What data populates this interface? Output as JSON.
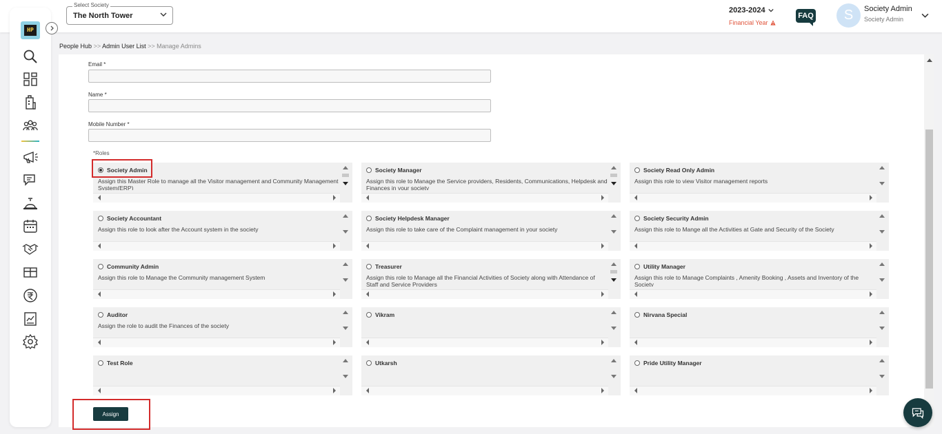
{
  "header": {
    "society_select_label": "Select Society",
    "society_select_value": "The North Tower",
    "financial_year": "2023-2024",
    "financial_year_label": "Financial Year",
    "faq": "FAQ",
    "user_initial": "S",
    "user_name": "Society Admin",
    "user_role": "Society Admin"
  },
  "sidebar": {
    "logo_text": "HP",
    "icons": [
      "search-icon",
      "dashboard-icon",
      "building-icon",
      "people-hub-icon",
      "announcement-icon",
      "chat-icon",
      "service-bell-icon",
      "calendar-icon",
      "handshake-icon",
      "amenity-icon",
      "rupee-icon",
      "report-icon",
      "settings-icon"
    ],
    "active": "people-hub-icon",
    "accent_colors": [
      "#f3c43f",
      "#2bb3c6"
    ]
  },
  "breadcrumb": {
    "items": [
      "People Hub",
      "Admin User List",
      "Manage Admins"
    ],
    "separator": ">>"
  },
  "form": {
    "email_label": "Email *",
    "email_value": "",
    "name_label": "Name *",
    "name_value": "",
    "mobile_label": "Mobile Number *",
    "mobile_value": "",
    "roles_label": "*Roles"
  },
  "roles": [
    {
      "name": "Society Admin",
      "desc": "Assign this Master Role to manage all the Visitor management and Community Management System(ERP)",
      "checked": true
    },
    {
      "name": "Society Manager",
      "desc": "Assign this role to Manage the Service providers, Residents, Communications, Helpdesk and Finances in your society",
      "checked": false
    },
    {
      "name": "Society Read Only Admin",
      "desc": "Assign this role to view Visitor management reports",
      "checked": false
    },
    {
      "name": "Society Accountant",
      "desc": "Assign this role to look after the Account system in the society",
      "checked": false
    },
    {
      "name": "Society Helpdesk Manager",
      "desc": "Assign this role to take care of the Complaint management in your society",
      "checked": false
    },
    {
      "name": "Society Security Admin",
      "desc": "Assign this role to Mange all the Activities at Gate and Security of the Society",
      "checked": false
    },
    {
      "name": "Community Admin",
      "desc": "Assign this role to Manage the Community management System",
      "checked": false
    },
    {
      "name": "Treasurer",
      "desc": "Assign this role to Manage all the Financial Activities of Society along with Attendance of Staff and Service Providers",
      "checked": false
    },
    {
      "name": "Utility Manager",
      "desc": "Assign this role to Manage Complaints , Amenity Booking , Assets and Inventory of the Society",
      "checked": false
    },
    {
      "name": "Auditor",
      "desc": "Assign the role to audit the Finances of the society",
      "checked": false
    },
    {
      "name": "Vikram",
      "desc": "",
      "checked": false
    },
    {
      "name": "Nirvana Special",
      "desc": "",
      "checked": false
    },
    {
      "name": "Test Role",
      "desc": "",
      "checked": false
    },
    {
      "name": "Utkarsh",
      "desc": "",
      "checked": false
    },
    {
      "name": "Pride Utility Manager",
      "desc": "",
      "checked": false
    }
  ],
  "actions": {
    "assign_label": "Assign"
  },
  "colors": {
    "brand_dark": "#173b3f",
    "highlight": "#d32b2b",
    "warning": "#e0533a"
  }
}
